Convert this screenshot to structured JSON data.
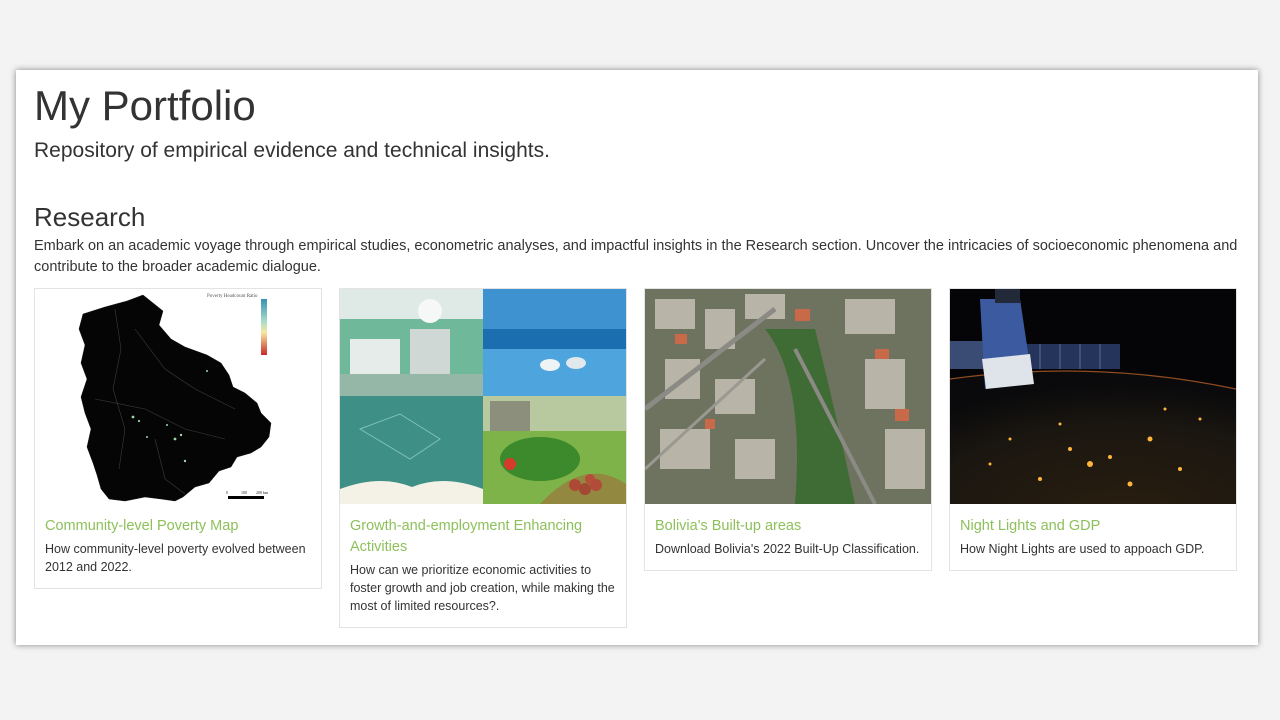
{
  "header": {
    "title": "My Portfolio",
    "subtitle": "Repository of empirical evidence and technical insights."
  },
  "research": {
    "title": "Research",
    "description": "Embark on an academic voyage through empirical studies, econometric analyses, and impactful insights in the Research section. Uncover the intricacies of socioeconomic phenomena and contribute to the broader academic dialogue."
  },
  "cards": [
    {
      "title": "Community-level Poverty Map",
      "text": "How community-level poverty evolved between 2012 and 2022.",
      "image": "bolivia-poverty-map-image",
      "map_legend_title": "Poverty Headcount Ratio",
      "scale_labels": [
        "0",
        "100",
        "200 km"
      ]
    },
    {
      "title": "Growth-and-employment Enhancing Activities",
      "text": "How can we prioritize economic activities to foster growth and job creation, while making the most of limited resources?.",
      "image": "collage-image"
    },
    {
      "title": "Bolivia's Built-up areas",
      "text": "Download Bolivia's 2022 Built-Up Classification.",
      "image": "aerial-city-image"
    },
    {
      "title": "Night Lights and GDP",
      "text": "How Night Lights are used to appoach GDP.",
      "image": "night-earth-image"
    }
  ],
  "colors": {
    "link_green": "#8dc05a",
    "text": "#333333",
    "background": "#f3f3f3"
  }
}
